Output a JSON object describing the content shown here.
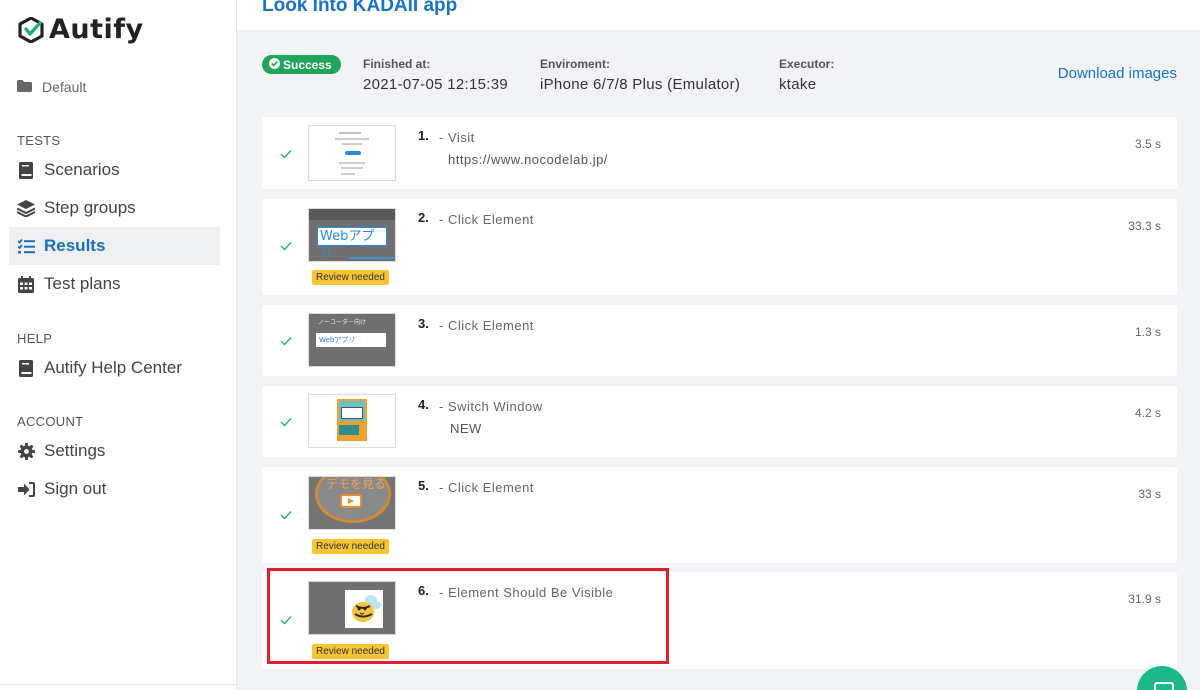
{
  "app": {
    "name": "Autify",
    "brand_color": "#1a73c8"
  },
  "sidebar": {
    "workspace": "Default",
    "sections": [
      {
        "label": "TESTS",
        "items": [
          {
            "label": "Scenarios",
            "icon": "book-icon"
          },
          {
            "label": "Step groups",
            "icon": "layers-icon"
          },
          {
            "label": "Results",
            "icon": "tasks-icon",
            "active": true
          },
          {
            "label": "Test plans",
            "icon": "calendar-icon"
          }
        ]
      },
      {
        "label": "HELP",
        "items": [
          {
            "label": "Autify Help Center",
            "icon": "book-icon"
          }
        ]
      },
      {
        "label": "ACCOUNT",
        "items": [
          {
            "label": "Settings",
            "icon": "gear-icon"
          },
          {
            "label": "Sign out",
            "icon": "sign-out-icon"
          }
        ]
      }
    ]
  },
  "page": {
    "title": "Look Into KADAII app"
  },
  "summary": {
    "status": "Success",
    "status_color": "#1fa45a",
    "finished_label": "Finished at:",
    "finished_value": "2021-07-05 12:15:39",
    "env_label": "Enviroment:",
    "env_value": "iPhone 6/7/8 Plus (Emulator)",
    "executor_label": "Executor:",
    "executor_value": "ktake",
    "download_label": "Download images"
  },
  "review_label": "Review needed",
  "steps": [
    {
      "num": "1.",
      "action": "- Visit",
      "detail": "https://www.nocodelab.jp/",
      "duration": "3.5 s",
      "review": false
    },
    {
      "num": "2.",
      "action": "- Click Element",
      "detail": "",
      "duration": "33.3 s",
      "review": true
    },
    {
      "num": "3.",
      "action": "- Click Element",
      "detail": "",
      "duration": "1.3 s",
      "review": false
    },
    {
      "num": "4.",
      "action": "- Switch Window",
      "detail": "NEW",
      "duration": "4.2 s",
      "review": false
    },
    {
      "num": "5.",
      "action": "- Click Element",
      "detail": "",
      "duration": "33 s",
      "review": true
    },
    {
      "num": "6.",
      "action": "- Element Should Be Visible",
      "detail": "",
      "duration": "31.9 s",
      "review": true
    }
  ],
  "thumbnails": {
    "step2_text": "Webアプリ",
    "step3_caption": "ノーコーダー向け",
    "step3_text": "Webアプリ",
    "step5_text": "デモを見る"
  }
}
